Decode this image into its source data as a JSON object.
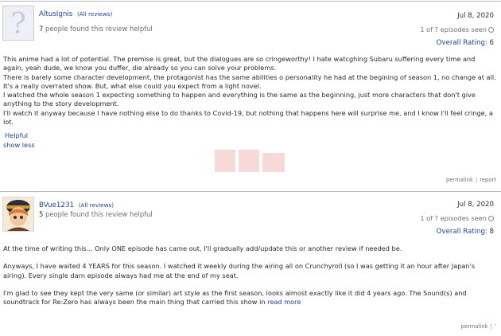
{
  "reviews": [
    {
      "username": "AltusIgnis",
      "all_reviews": "(All reviews)",
      "helpful_count": "7",
      "helpful_text": "people found this review helpful",
      "date": "Jul 8, 2020",
      "episodes": "1 of ? episodes seen",
      "rating_label": "Overall Rating:",
      "rating_value": "6",
      "paragraphs": [
        "This anime had a lot of potential. The premise is great, but the dialogues are so cringeworthy! I hate watcghing Subaru suffering every time and again, yeah dude, we know you duffer, die already so you can solve your problems.",
        "There is barely some character development, the protagonist has the same abilities o personality he had at the begining of season 1, no change at all.",
        "It's a really overrated show. But, what else could you expect from a light novel.",
        "I watched the whole season 1 expecting something to happen and everything is the same as the beginning, just more characters that don't give anything to the story development.",
        "I'll watch it anyway because I have nothing else to do thanks to Covid-19, but nothing that happens here will surprise me, and I know I'll feel cringe, a lot."
      ],
      "helpful_button": "Helpful",
      "show_less": "show less",
      "permalink": "permalink",
      "report": "report"
    },
    {
      "username": "BVue1231",
      "all_reviews": "(All reviews)",
      "helpful_count": "5",
      "helpful_text": "people found this review helpful",
      "date": "Jul 8, 2020",
      "episodes": "1 of ? episodes seen",
      "rating_label": "Overall Rating:",
      "rating_value": "8",
      "paragraphs": [
        "At the time of writing this... Only ONE episode has came out, I'll gradually add/update this or another review if needed be.",
        "Anyways, I have waited 4 YEARS for this season. I watched it weekly during the airing all on Crunchyroll (so I was getting it an hour after Japan's airing). Every single darn episode always had me at the end of my seat.",
        "I'm glad to see they kept the very same (or similar) art style as the first season, looks almost exactly like it did 4 years ago. The Sound(s) and soundtrack for Re:Zero has always been the main thing that carried this show in"
      ],
      "read_more": "read more",
      "permalink": "permalink",
      "report": "’"
    }
  ],
  "colors": {
    "link": "#1c439b",
    "divider": "#b4b8c8",
    "muted": "#707070"
  },
  "icons": [
    "default-avatar-icon",
    "anime-avatar-icon",
    "episodes-icon"
  ]
}
